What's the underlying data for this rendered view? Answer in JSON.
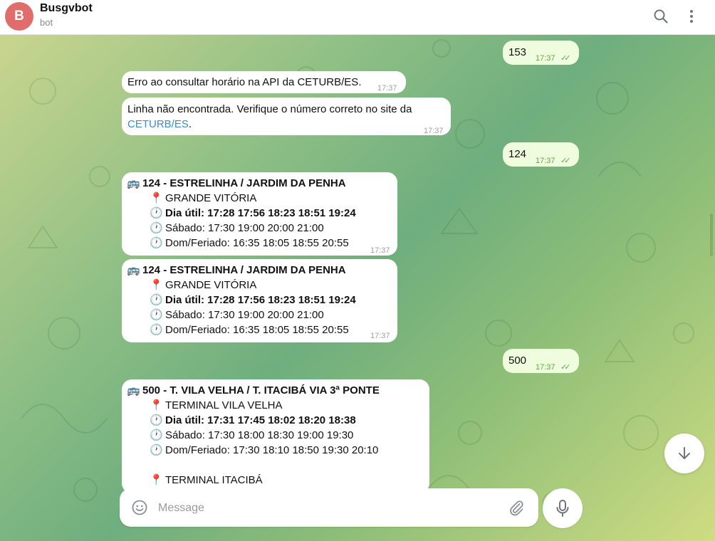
{
  "header": {
    "avatar_letter": "B",
    "title": "Busgvbot",
    "subtitle": "bot"
  },
  "messages": {
    "m1": {
      "text": "153",
      "time": "17:37"
    },
    "m2": {
      "text": "Erro ao consultar horário na API da CETURB/ES.",
      "time": "17:37"
    },
    "m3": {
      "text_before": "Linha não encontrada. Verifique o número correto no site da",
      "link": "CETURB/ES",
      "text_after": ".",
      "time": "17:37"
    },
    "m4": {
      "text": "124",
      "time": "17:37"
    },
    "m5": {
      "title": "124 - ESTRELINHA / JARDIM DA PENHA",
      "place": "GRANDE VITÓRIA",
      "weekday": "Dia útil: 17:28 17:56 18:23 18:51 19:24",
      "saturday": "Sábado: 17:30 19:00 20:00 21:00",
      "sunday": "Dom/Feriado: 16:35 18:05 18:55 20:55",
      "time": "17:37"
    },
    "m6": {
      "title": "124 - ESTRELINHA / JARDIM DA PENHA",
      "place": "GRANDE VITÓRIA",
      "weekday": "Dia útil: 17:28 17:56 18:23 18:51 19:24",
      "saturday": "Sábado: 17:30 19:00 20:00 21:00",
      "sunday": "Dom/Feriado: 16:35 18:05 18:55 20:55",
      "time": "17:37"
    },
    "m7": {
      "text": "500",
      "time": "17:37"
    },
    "m8": {
      "title": "500 - T. VILA VELHA / T. ITACIBÁ VIA 3ª PONTE",
      "place": "TERMINAL VILA VELHA",
      "weekday": "Dia útil: 17:31 17:45 18:02 18:20 18:38",
      "saturday": "Sábado: 17:30 18:00 18:30 19:00 19:30",
      "sunday": "Dom/Feriado: 17:30 18:10 18:50 19:30 20:10",
      "place2": "TERMINAL ITACIBÁ"
    }
  },
  "emoji": {
    "bus": "🚌",
    "pin": "📍",
    "clock": "🕐"
  },
  "ticks": "✓✓",
  "composer": {
    "placeholder": "Message"
  },
  "icons": [
    "search-icon",
    "more-vertical-icon",
    "arrow-down-icon",
    "emoji-icon",
    "paperclip-icon",
    "microphone-icon"
  ]
}
